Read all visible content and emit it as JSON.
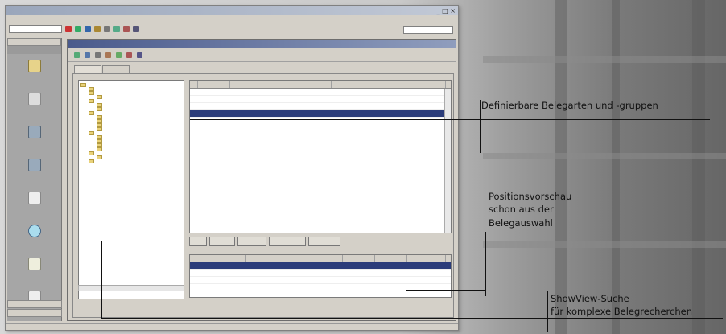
{
  "callouts": {
    "belegarten": "Definierbare Belegarten und -gruppen",
    "positionsvorschau_l1": "Positionsvorschau",
    "positionsvorschau_l2": "schon aus der",
    "positionsvorschau_l3": "Belegauswahl",
    "showview_l1": "ShowView-Suche",
    "showview_l2": "für komplexe Belegrecherchen"
  },
  "colors": {
    "selection": "#2b3c7a",
    "window_bg": "#d4d0c8",
    "callout_text": "#111111"
  }
}
